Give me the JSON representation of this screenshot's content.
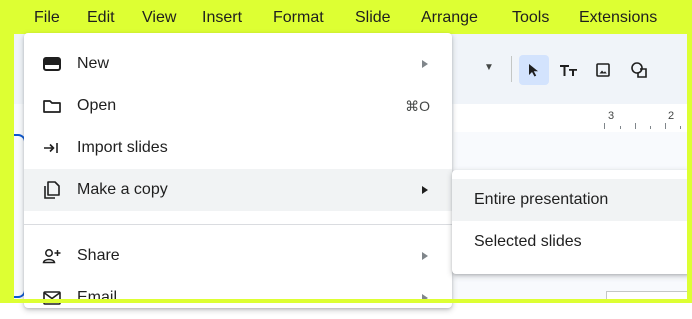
{
  "menubar": {
    "items": [
      {
        "label": "File"
      },
      {
        "label": "Edit"
      },
      {
        "label": "View"
      },
      {
        "label": "Insert"
      },
      {
        "label": "Format"
      },
      {
        "label": "Slide"
      },
      {
        "label": "Arrange"
      },
      {
        "label": "Tools"
      },
      {
        "label": "Extensions"
      }
    ]
  },
  "ruler": {
    "numbers": [
      "3",
      "2"
    ]
  },
  "file_menu": {
    "items": [
      {
        "label": "New",
        "icon": "new-slides-icon",
        "has_submenu": true
      },
      {
        "label": "Open",
        "icon": "folder-icon",
        "shortcut": "⌘O"
      },
      {
        "label": "Import slides",
        "icon": "import-icon"
      },
      {
        "label": "Make a copy",
        "icon": "copy-icon",
        "has_submenu": true
      },
      {
        "label": "Share",
        "icon": "share-person-icon",
        "has_submenu": true
      },
      {
        "label": "Email",
        "icon": "email-icon",
        "has_submenu": true
      }
    ]
  },
  "submenu": {
    "items": [
      {
        "label": "Entire presentation"
      },
      {
        "label": "Selected slides"
      }
    ]
  },
  "colors": {
    "frame": "#ddff33",
    "hover": "#f1f3f4",
    "selected_tool": "#d3e3fd"
  }
}
